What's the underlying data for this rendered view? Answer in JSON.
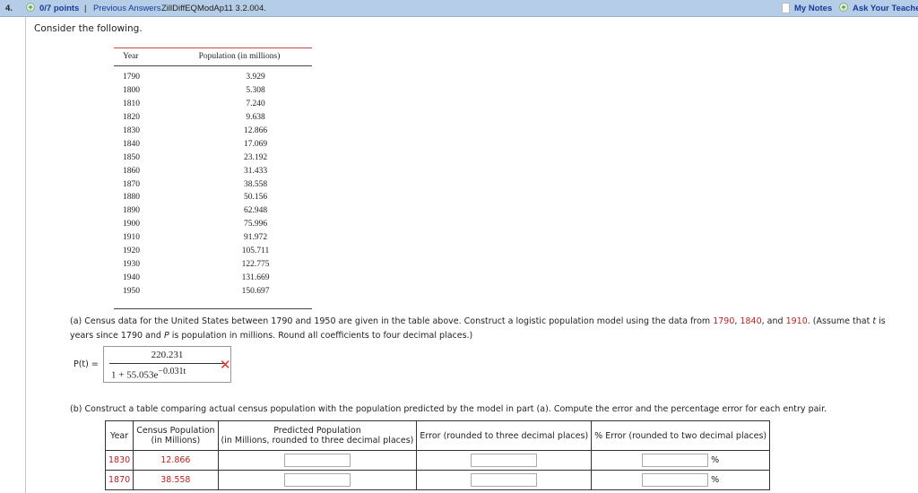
{
  "header": {
    "question_number": "4.",
    "points": "0/7 points",
    "separator": "|",
    "previous_answers": "Previous Answers",
    "problem_id": "ZillDiffEQModAp11 3.2.004.",
    "my_notes": "My Notes",
    "ask_teacher": "Ask Your Teacher"
  },
  "intro": "Consider the following.",
  "population_table": {
    "headers": [
      "Year",
      "Population (in millions)"
    ],
    "rows": [
      [
        "1790",
        "3.929"
      ],
      [
        "1800",
        "5.308"
      ],
      [
        "1810",
        "7.240"
      ],
      [
        "1820",
        "9.638"
      ],
      [
        "1830",
        "12.866"
      ],
      [
        "1840",
        "17.069"
      ],
      [
        "1850",
        "23.192"
      ],
      [
        "1860",
        "31.433"
      ],
      [
        "1870",
        "38.558"
      ],
      [
        "1880",
        "50.156"
      ],
      [
        "1890",
        "62.948"
      ],
      [
        "1900",
        "75.996"
      ],
      [
        "1910",
        "91.972"
      ],
      [
        "1920",
        "105.711"
      ],
      [
        "1930",
        "122.775"
      ],
      [
        "1940",
        "131.669"
      ],
      [
        "1950",
        "150.697"
      ]
    ]
  },
  "part_a": {
    "text1": "(a) Census data for the United States between 1790 and 1950 are given in the table above. Construct a logistic population model using the data from ",
    "y1": "1790",
    "comma1": ", ",
    "y2": "1840",
    "comma2": ", and ",
    "y3": "1910",
    "text2": ". (Assume that ",
    "t": "t",
    "text3": " is",
    "text4": "years since 1790 and ",
    "P": "P",
    "text5": " is population in millions. Round all coefficients to four decimal places.)",
    "label": "P(t) =",
    "numerator": "220.231",
    "denominator": "1 + 55.053e",
    "exponent": "−0.031t",
    "status": "incorrect",
    "status_color": "#e03030"
  },
  "part_b": {
    "text": "(b) Construct a table comparing actual census population with the population predicted by the model in part (a). Compute the error and the percentage error for each entry pair.",
    "headers": [
      "Year",
      "Census Population",
      "(in Millions)",
      "Predicted Population",
      "(in Millions, rounded to three decimal places)",
      "Error (rounded to three decimal places)",
      "% Error (rounded to two decimal places)"
    ],
    "rows": [
      {
        "year": "1830",
        "census": "12.866",
        "predicted": "",
        "error": "",
        "pct_error": "",
        "pct": "%"
      },
      {
        "year": "1870",
        "census": "38.558",
        "predicted": "",
        "error": "",
        "pct_error": "",
        "pct": "%"
      }
    ]
  }
}
